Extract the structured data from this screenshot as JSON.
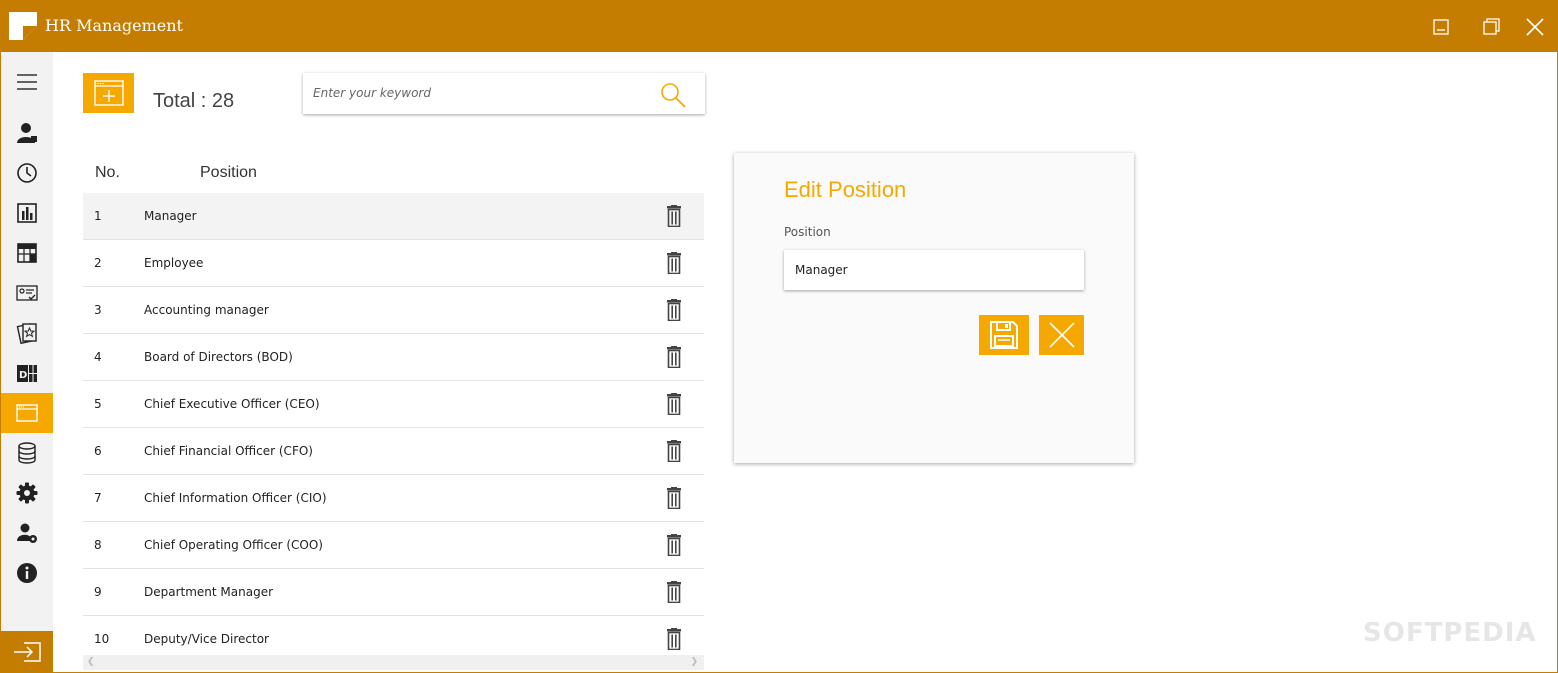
{
  "window": {
    "title": "HR Management",
    "accent": "#c47d00",
    "highlight": "#f5a800"
  },
  "sidebar": {
    "items": [
      {
        "icon": "hamburger-menu-icon",
        "active": false
      },
      {
        "icon": "employee-icon",
        "active": false
      },
      {
        "icon": "clock-icon",
        "active": false
      },
      {
        "icon": "report-chart-icon",
        "active": false
      },
      {
        "icon": "calendar-grid-icon",
        "active": false
      },
      {
        "icon": "id-card-check-icon",
        "active": false
      },
      {
        "icon": "award-card-icon",
        "active": false
      },
      {
        "icon": "department-icon",
        "active": false
      },
      {
        "icon": "position-window-icon",
        "active": true
      },
      {
        "icon": "database-icon",
        "active": false
      },
      {
        "icon": "gear-icon",
        "active": false
      },
      {
        "icon": "user-settings-icon",
        "active": false
      },
      {
        "icon": "info-icon",
        "active": false
      }
    ],
    "exit_icon": "sign-out-icon"
  },
  "toolbar": {
    "total_label": "Total : 28",
    "search_placeholder": "Enter your keyword"
  },
  "table": {
    "headers": {
      "no": "No.",
      "position": "Position"
    },
    "selected_index": 0,
    "rows": [
      {
        "no": "1",
        "position": "Manager"
      },
      {
        "no": "2",
        "position": "Employee"
      },
      {
        "no": "3",
        "position": "Accounting manager"
      },
      {
        "no": "4",
        "position": "Board of Directors (BOD)"
      },
      {
        "no": "5",
        "position": "Chief Executive Officer (CEO)"
      },
      {
        "no": "6",
        "position": "Chief Financial Officer (CFO)"
      },
      {
        "no": "7",
        "position": "Chief Information Officer (CIO)"
      },
      {
        "no": "8",
        "position": "Chief Operating Officer (COO)"
      },
      {
        "no": "9",
        "position": "Department Manager"
      },
      {
        "no": "10",
        "position": "Deputy/Vice Director"
      }
    ]
  },
  "edit": {
    "title": "Edit Position",
    "field_label": "Position",
    "field_value": "Manager"
  },
  "watermark": "SOFTPEDIA"
}
